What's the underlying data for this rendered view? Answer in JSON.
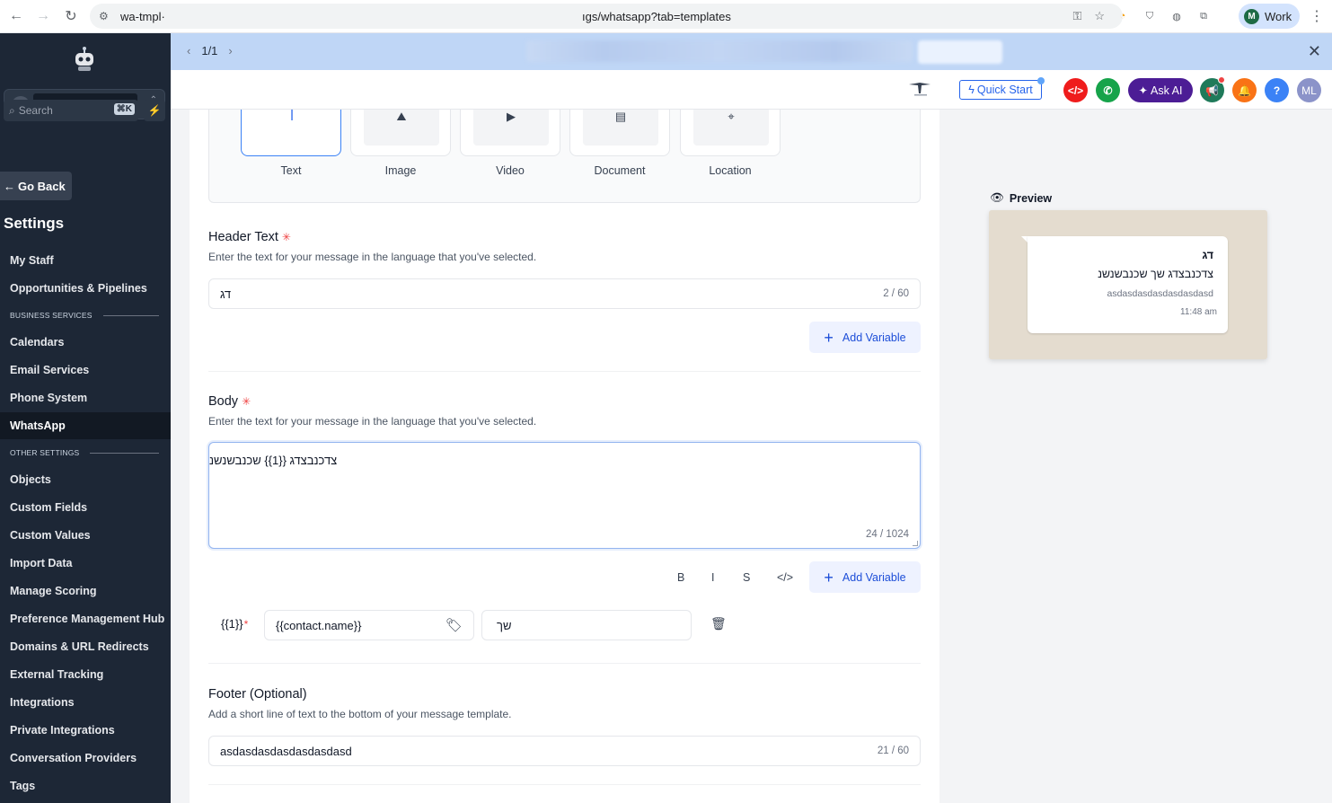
{
  "browser": {
    "tab_host": "wa-tmpl·",
    "url_path": "ıgs/whatsapp?tab=templates",
    "profile_initial": "M",
    "profile_name": "Work"
  },
  "sidebar": {
    "go_back": "Go Back",
    "settings_title": "Settings",
    "search_placeholder": "Search",
    "search_shortcut": "⌘K",
    "items": [
      {
        "label": "My Staff"
      },
      {
        "label": "Opportunities & Pipelines"
      },
      {
        "label": "Calendars"
      },
      {
        "label": "Email Services"
      },
      {
        "label": "Phone System"
      },
      {
        "label": "WhatsApp"
      },
      {
        "label": "Objects"
      },
      {
        "label": "Custom Fields"
      },
      {
        "label": "Custom Values"
      },
      {
        "label": "Import Data"
      },
      {
        "label": "Manage Scoring"
      },
      {
        "label": "Preference Management Hub"
      },
      {
        "label": "Domains & URL Redirects"
      },
      {
        "label": "External Tracking"
      },
      {
        "label": "Integrations"
      },
      {
        "label": "Private Integrations"
      },
      {
        "label": "Conversation Providers"
      },
      {
        "label": "Tags"
      }
    ],
    "sections": {
      "business": "BUSINESS SERVICES",
      "other": "OTHER SETTINGS"
    }
  },
  "banner": {
    "pager": "1/1"
  },
  "topbar": {
    "quick_start": "Quick Start",
    "ask_ai": "Ask AI",
    "user_initials": "ML",
    "help": "?"
  },
  "form": {
    "header_types": [
      "Text",
      "Image",
      "Video",
      "Document",
      "Location"
    ],
    "header_text": {
      "title": "Header Text",
      "description": "Enter the text for your message in the language that you've selected.",
      "value": "דג",
      "counter": "2 / 60"
    },
    "add_variable": "Add Variable",
    "body": {
      "title": "Body",
      "description": "Enter the text for your message in the language that you've selected.",
      "value": "צדכנבצדג  {{1}} שכנבשנשנ",
      "counter": "24 / 1024"
    },
    "format_buttons": {
      "bold": "B",
      "italic": "I",
      "strike": "S",
      "code": "</>"
    },
    "variable": {
      "tag": "{{1}}",
      "field": "{{contact.name}}",
      "sample": "שך"
    },
    "footer": {
      "title": "Footer (Optional)",
      "description": "Add a short line of text to the bottom of your message template.",
      "value": "asdasdasdasdasdasdasd",
      "counter": "21 / 60"
    }
  },
  "preview": {
    "label": "Preview",
    "header": "דג",
    "body": "צדכנבצדג   שך שכנבשנשנ",
    "footer": "asdasdasdasdasdasdasd",
    "time": "11:48 am"
  },
  "colors": {
    "sidebar_bg": "#1d2736",
    "accent": "#2563eb",
    "banner": "#bfd6f6",
    "ask_ai": "#4c1d95"
  }
}
